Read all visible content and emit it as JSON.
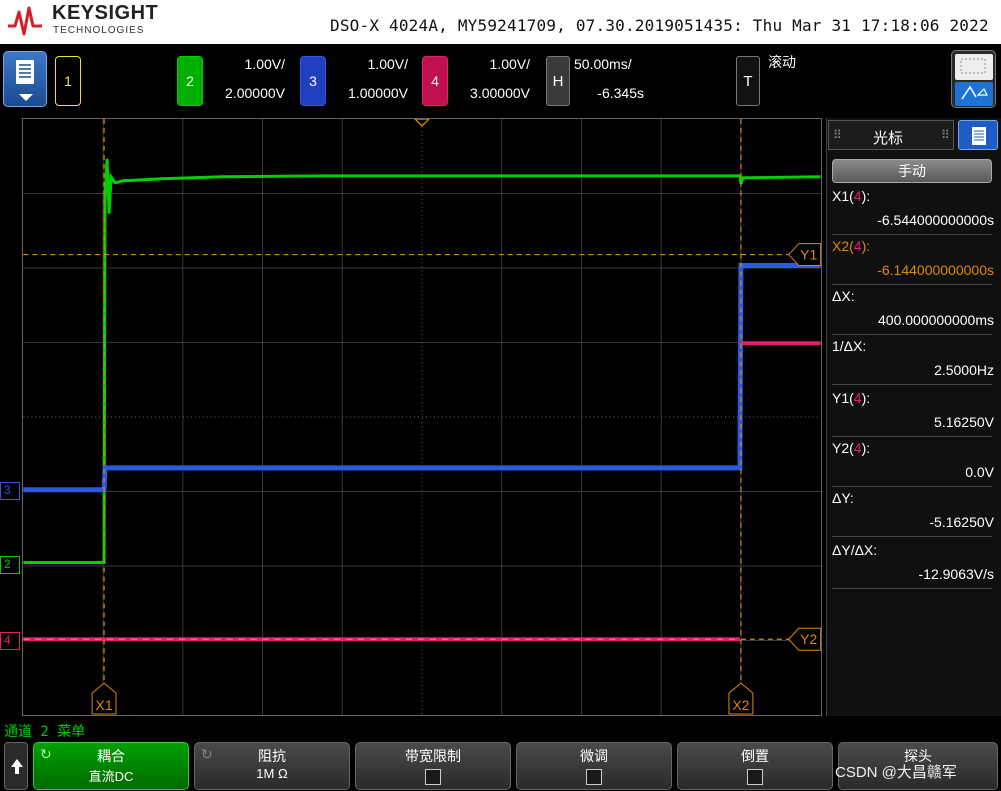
{
  "header": {
    "brand": "KEYSIGHT",
    "brand_sub": "TECHNOLOGIES",
    "device_info": "DSO-X 4024A, MY59241709, 07.30.2019051435: Thu Mar 31 17:18:06 2022"
  },
  "channels": {
    "ch1": {
      "num": "1",
      "color": "#f0e030"
    },
    "ch2": {
      "num": "2",
      "color": "#00d000",
      "scale": "1.00V/",
      "offset": "2.00000V"
    },
    "ch3": {
      "num": "3",
      "color": "#2a5ae0",
      "scale": "1.00V/",
      "offset": "1.00000V"
    },
    "ch4": {
      "num": "4",
      "color": "#e0206a",
      "scale": "1.00V/",
      "offset": "3.00000V"
    }
  },
  "horizontal": {
    "label": "H",
    "scale": "50.00ms/",
    "position": "-6.345s"
  },
  "trigger": {
    "label": "T",
    "mode": "滚动"
  },
  "markers": {
    "x1": "X1",
    "x2": "X2",
    "y1": "Y1",
    "y2": "Y2",
    "ch2": "2",
    "ch3": "3",
    "ch4": "4"
  },
  "cursor_panel": {
    "title": "光标",
    "mode": "手动",
    "x1_label": "X1(",
    "x1_ch": "4",
    "x1_close": "):",
    "x1_value": "-6.544000000000s",
    "x2_label": "X2(",
    "x2_ch": "4",
    "x2_close": "):",
    "x2_value": "-6.144000000000s",
    "dx_label": "ΔX:",
    "dx_value": "400.000000000ms",
    "inv_label": "1/ΔX:",
    "inv_value": "2.5000Hz",
    "y1_label": "Y1(",
    "y1_ch": "4",
    "y1_close": "):",
    "y1_value": "5.16250V",
    "y2_label": "Y2(",
    "y2_ch": "4",
    "y2_close": "):",
    "y2_value": "0.0V",
    "dy_label": "ΔY:",
    "dy_value": "-5.16250V",
    "dydx_label": "ΔY/ΔX:",
    "dydx_value": "-12.9063V/s"
  },
  "menu": {
    "title": "通道 2 菜单"
  },
  "softkeys": [
    {
      "top": "耦合",
      "bottom": "直流DC"
    },
    {
      "top": "阻抗",
      "bottom": "1M Ω"
    },
    {
      "top": "带宽限制"
    },
    {
      "top": "微调"
    },
    {
      "top": "倒置"
    },
    {
      "top": "探头"
    }
  ],
  "watermark": "CSDN @大昌赣军"
}
